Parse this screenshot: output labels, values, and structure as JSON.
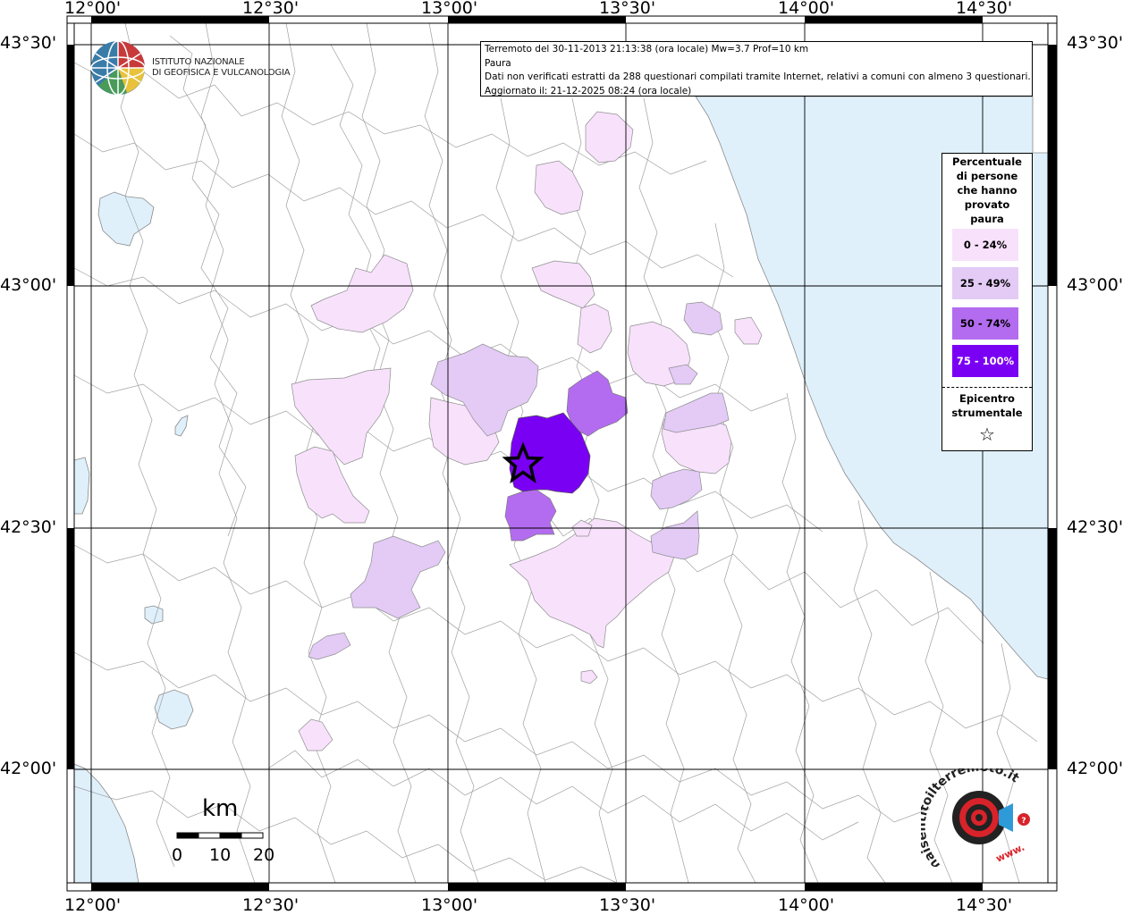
{
  "map": {
    "lon_labels_top": [
      "12°00'",
      "12°30'",
      "13°00'",
      "13°30'",
      "14°00'",
      "14°30'"
    ],
    "lon_labels_bottom": [
      "12°00'",
      "12°30'",
      "13°00'",
      "13°30'",
      "14°00'",
      "14°30'"
    ],
    "lat_labels_left": [
      "43°30'",
      "43°00'",
      "42°30'",
      "42°00'"
    ],
    "lat_labels_right": [
      "43°30'",
      "43°00'",
      "42°30'",
      "42°00'"
    ]
  },
  "info": {
    "line1": "Terremoto del 30-11-2013 21:13:38 (ora locale) Mw=3.7 Prof=10 km",
    "line2": "Paura",
    "line3": "Dati non verificati estratti da 288 questionari compilati tramite Internet, relativi a comuni con almeno 3 questionari.",
    "line4": "Aggiornato il: 21-12-2025 08:24 (ora locale)"
  },
  "logo_ingv": {
    "line1": "ISTITUTO NAZIONALE",
    "line2": "DI GEOFISICA E VULCANOLOGIA"
  },
  "legend": {
    "title_lines": [
      "Percentuale",
      "di persone",
      "che hanno",
      "provato",
      "paura"
    ],
    "classes": [
      {
        "label": "0 - 24%",
        "color": "#f7e1fb"
      },
      {
        "label": "25 - 49%",
        "color": "#e3cbf6"
      },
      {
        "label": "50 - 74%",
        "color": "#b36cf0"
      },
      {
        "label": "75 - 100%",
        "color": "#7a00f4"
      }
    ],
    "epicenter_lines": [
      "Epicentro",
      "strumentale"
    ],
    "epicenter_symbol": "☆"
  },
  "scale_bar": {
    "unit": "km",
    "labels": [
      "0",
      "10",
      "20"
    ]
  },
  "colors": {
    "sea": "#dff0fb",
    "border": "#9a9a9a",
    "grid": "#000000"
  }
}
